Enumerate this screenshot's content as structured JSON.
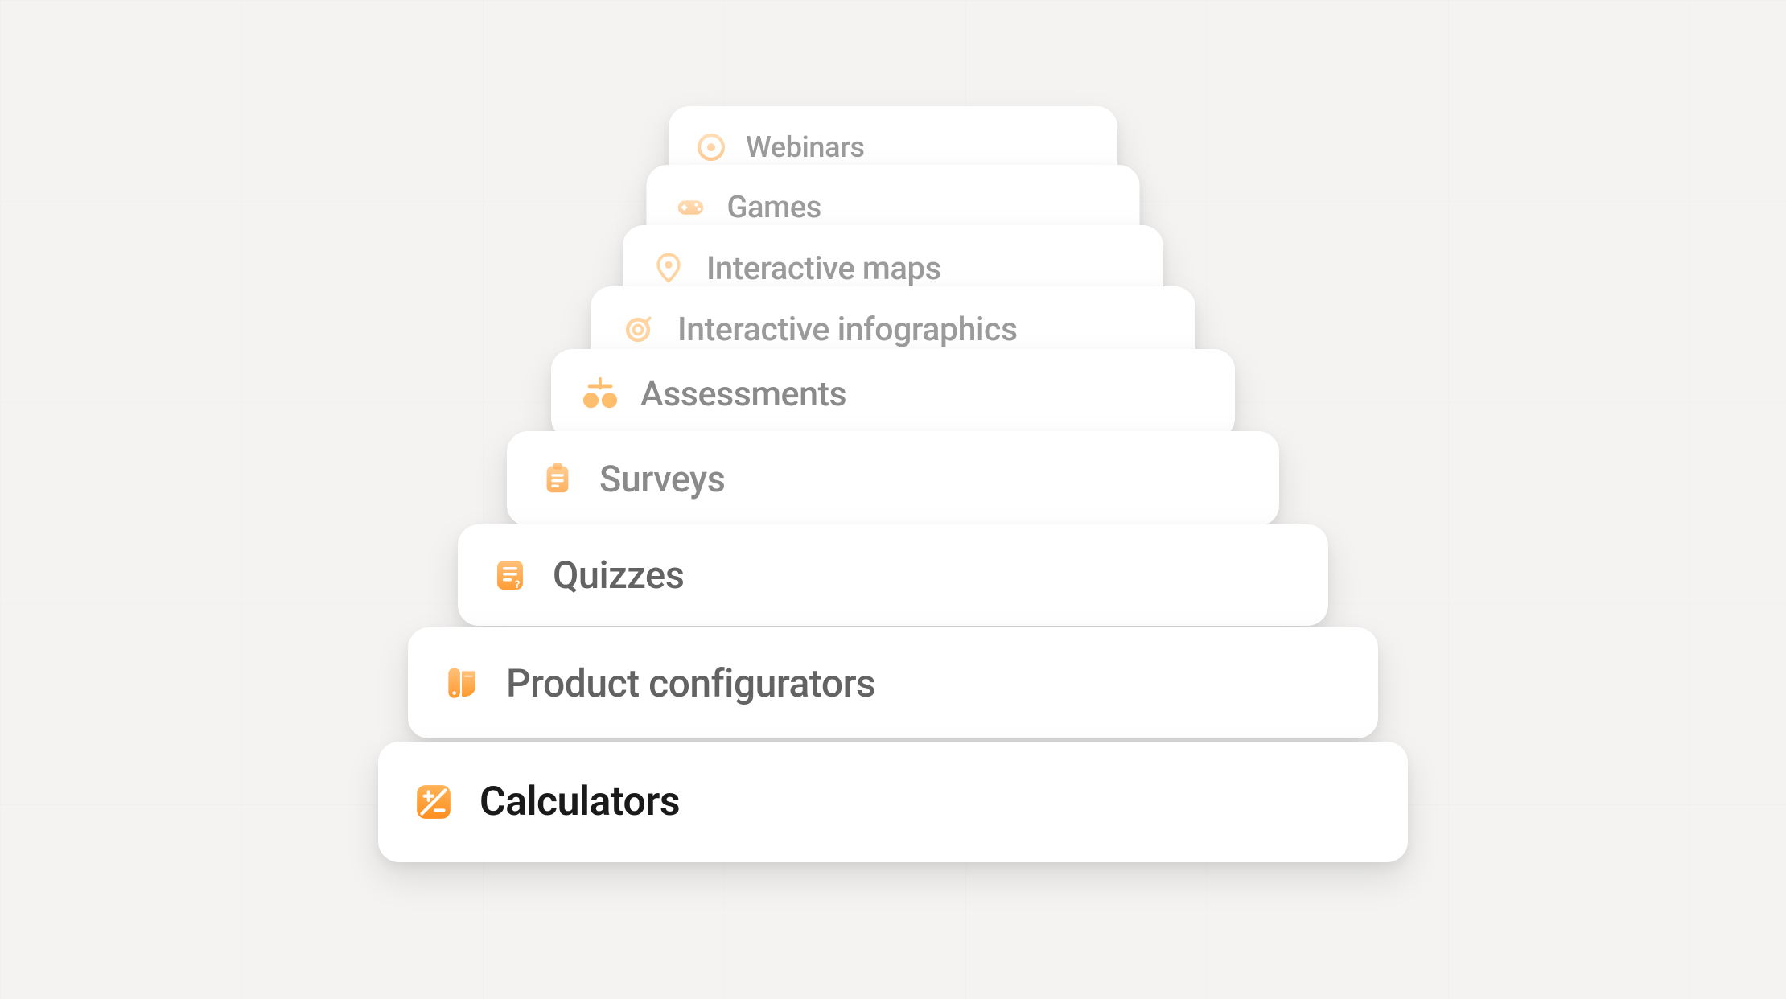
{
  "accent": {
    "grad_start": "#ffb255",
    "grad_end": "#ff9a2e",
    "solid": "#f7a13a"
  },
  "cards": [
    {
      "label": "Webinars",
      "icon": "webinars-icon"
    },
    {
      "label": "Games",
      "icon": "games-icon"
    },
    {
      "label": "Interactive maps",
      "icon": "interactive-maps-icon"
    },
    {
      "label": "Interactive infographics",
      "icon": "interactive-infographics-icon"
    },
    {
      "label": "Assessments",
      "icon": "assessments-icon"
    },
    {
      "label": "Surveys",
      "icon": "surveys-icon"
    },
    {
      "label": "Quizzes",
      "icon": "quizzes-icon"
    },
    {
      "label": "Product configurators",
      "icon": "product-configurators-icon"
    },
    {
      "label": "Calculators",
      "icon": "calculators-icon"
    }
  ]
}
